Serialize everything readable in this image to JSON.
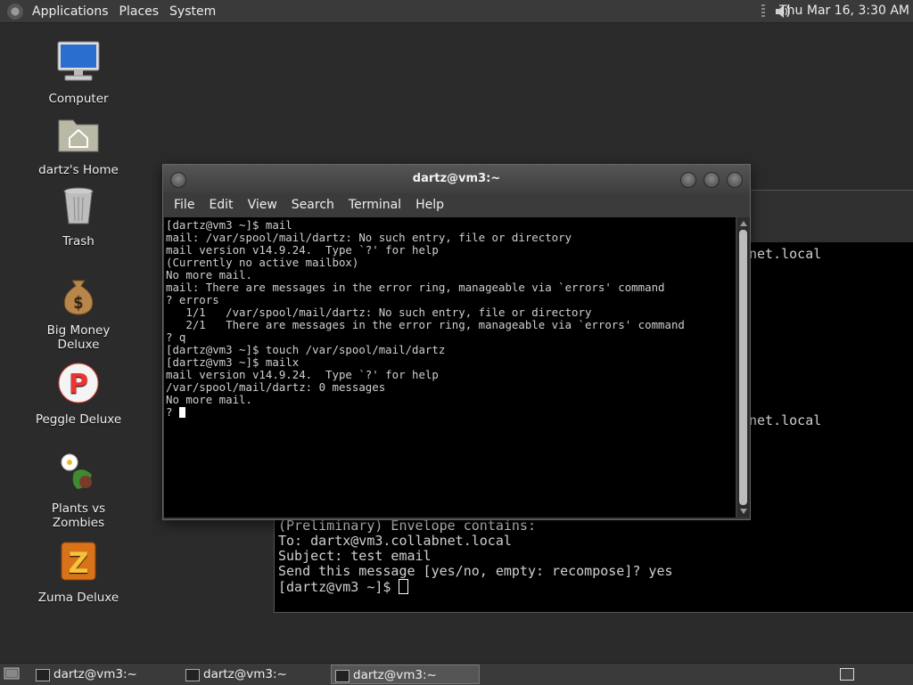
{
  "top_panel": {
    "menus": [
      "Applications",
      "Places",
      "System"
    ],
    "clock": "Thu Mar 16,  3:30 AM",
    "icons": [
      "applications-icon",
      "volume-icon"
    ]
  },
  "desktop_icons": [
    {
      "label": "Computer",
      "icon": "computer-icon"
    },
    {
      "label": "dartz's Home",
      "icon": "home-folder-icon"
    },
    {
      "label": "Trash",
      "icon": "trash-icon"
    },
    {
      "label": "Big Money Deluxe",
      "icon": "money-bag-icon"
    },
    {
      "label": "Peggle Deluxe",
      "icon": "peggle-icon"
    },
    {
      "label": "Plants vs Zombies",
      "icon": "plants-icon"
    },
    {
      "label": "Zuma Deluxe",
      "icon": "zuma-icon"
    }
  ],
  "front_terminal": {
    "title": "dartz@vm3:~",
    "menus": [
      "File",
      "Edit",
      "View",
      "Search",
      "Terminal",
      "Help"
    ],
    "lines": [
      "[dartz@vm3 ~]$ mail",
      "mail: /var/spool/mail/dartz: No such entry, file or directory",
      "mail version v14.9.24.  Type `?' for help",
      "(Currently no active mailbox)",
      "No more mail.",
      "mail: There are messages in the error ring, manageable via `errors' command",
      "? errors",
      "   1/1   /var/spool/mail/dartz: No such entry, file or directory",
      "   2/1   There are messages in the error ring, manageable via `errors' command",
      "? q",
      "[dartz@vm3 ~]$ touch /var/spool/mail/dartz",
      "[dartz@vm3 ~]$ mailx",
      "mail version v14.9.24.  Type `?' for help",
      "/var/spool/mail/dartz: 0 messages",
      "No more mail.",
      "? "
    ]
  },
  "back_terminal": {
    "fragments": [
      "net.local",
      "net.local"
    ],
    "tail_lines": [
      "(Preliminary) Envelope contains:",
      "To: dartx@vm3.collabnet.local",
      "Subject: test email",
      "Send this message [yes/no, empty: recompose]? yes",
      "[dartz@vm3 ~]$ "
    ]
  },
  "taskbar": {
    "tasks": [
      {
        "label": "dartz@vm3:~",
        "active": false
      },
      {
        "label": "dartz@vm3:~",
        "active": false
      },
      {
        "label": "dartz@vm3:~",
        "active": true
      }
    ]
  }
}
